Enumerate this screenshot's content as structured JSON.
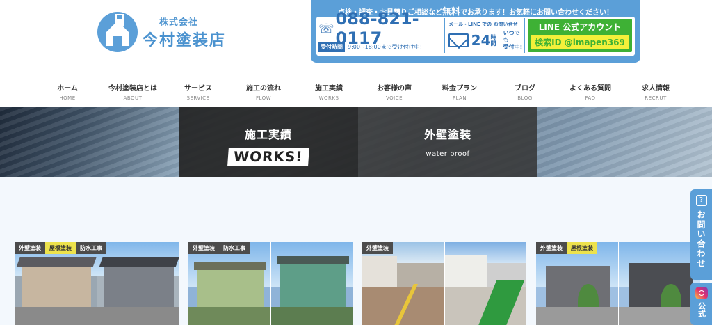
{
  "header": {
    "logo_sub": "株式会社",
    "logo_main": "今村塗装店",
    "contact_banner_pre": "点検・調査・お見積りご相談など",
    "contact_banner_em": "無料",
    "contact_banner_post": "でお承ります！お気軽にお問い合わせください！",
    "tel_number": "088-821-0117",
    "tel_hours_label": "受付時間",
    "tel_hours": "9:00~18:00まで受け付け中!!",
    "mail_title": "メール・LINE での お問い合せ",
    "mail_24": "24",
    "mail_jikan": "時間",
    "mail_anytime_1": "いつでも",
    "mail_anytime_2": "受付中!",
    "line_title": "LINE 公式アカウント",
    "line_id": "検索ID @imapen369"
  },
  "nav": [
    {
      "jp": "ホーム",
      "en": "HOME"
    },
    {
      "jp": "今村塗装店とは",
      "en": "ABOUT"
    },
    {
      "jp": "サービス",
      "en": "SERVICE"
    },
    {
      "jp": "施工の流れ",
      "en": "FLOW"
    },
    {
      "jp": "施工実績",
      "en": "WORKS"
    },
    {
      "jp": "お客様の声",
      "en": "VOICE"
    },
    {
      "jp": "料金プラン",
      "en": "PLAN"
    },
    {
      "jp": "ブログ",
      "en": "BLOG"
    },
    {
      "jp": "よくある質問",
      "en": "FAQ"
    },
    {
      "jp": "求人情報",
      "en": "RECRUT"
    }
  ],
  "hero": {
    "card1_jp": "施工実績",
    "card1_en": "WORKS!",
    "card2_jp": "外壁塗装",
    "card2_en": "water proof"
  },
  "cards": [
    {
      "tags": [
        {
          "text": "外壁塗装",
          "color": "gray"
        },
        {
          "text": "屋根塗装",
          "color": "yellow"
        },
        {
          "text": "防水工事",
          "color": "gray"
        }
      ]
    },
    {
      "tags": [
        {
          "text": "外壁塗装",
          "color": "gray"
        },
        {
          "text": "防水工事",
          "color": "gray"
        }
      ]
    },
    {
      "tags": [
        {
          "text": "外壁塗装",
          "color": "gray"
        }
      ]
    },
    {
      "tags": [
        {
          "text": "外壁塗装",
          "color": "gray"
        },
        {
          "text": "屋根塗装",
          "color": "yellow"
        }
      ]
    }
  ],
  "side": {
    "contact_label": "お問い合わせ",
    "insta_label": "公式"
  },
  "colors": {
    "brand_blue": "#5b9fd8",
    "line_green": "#3eb135",
    "tag_yellow": "#ede24c"
  }
}
